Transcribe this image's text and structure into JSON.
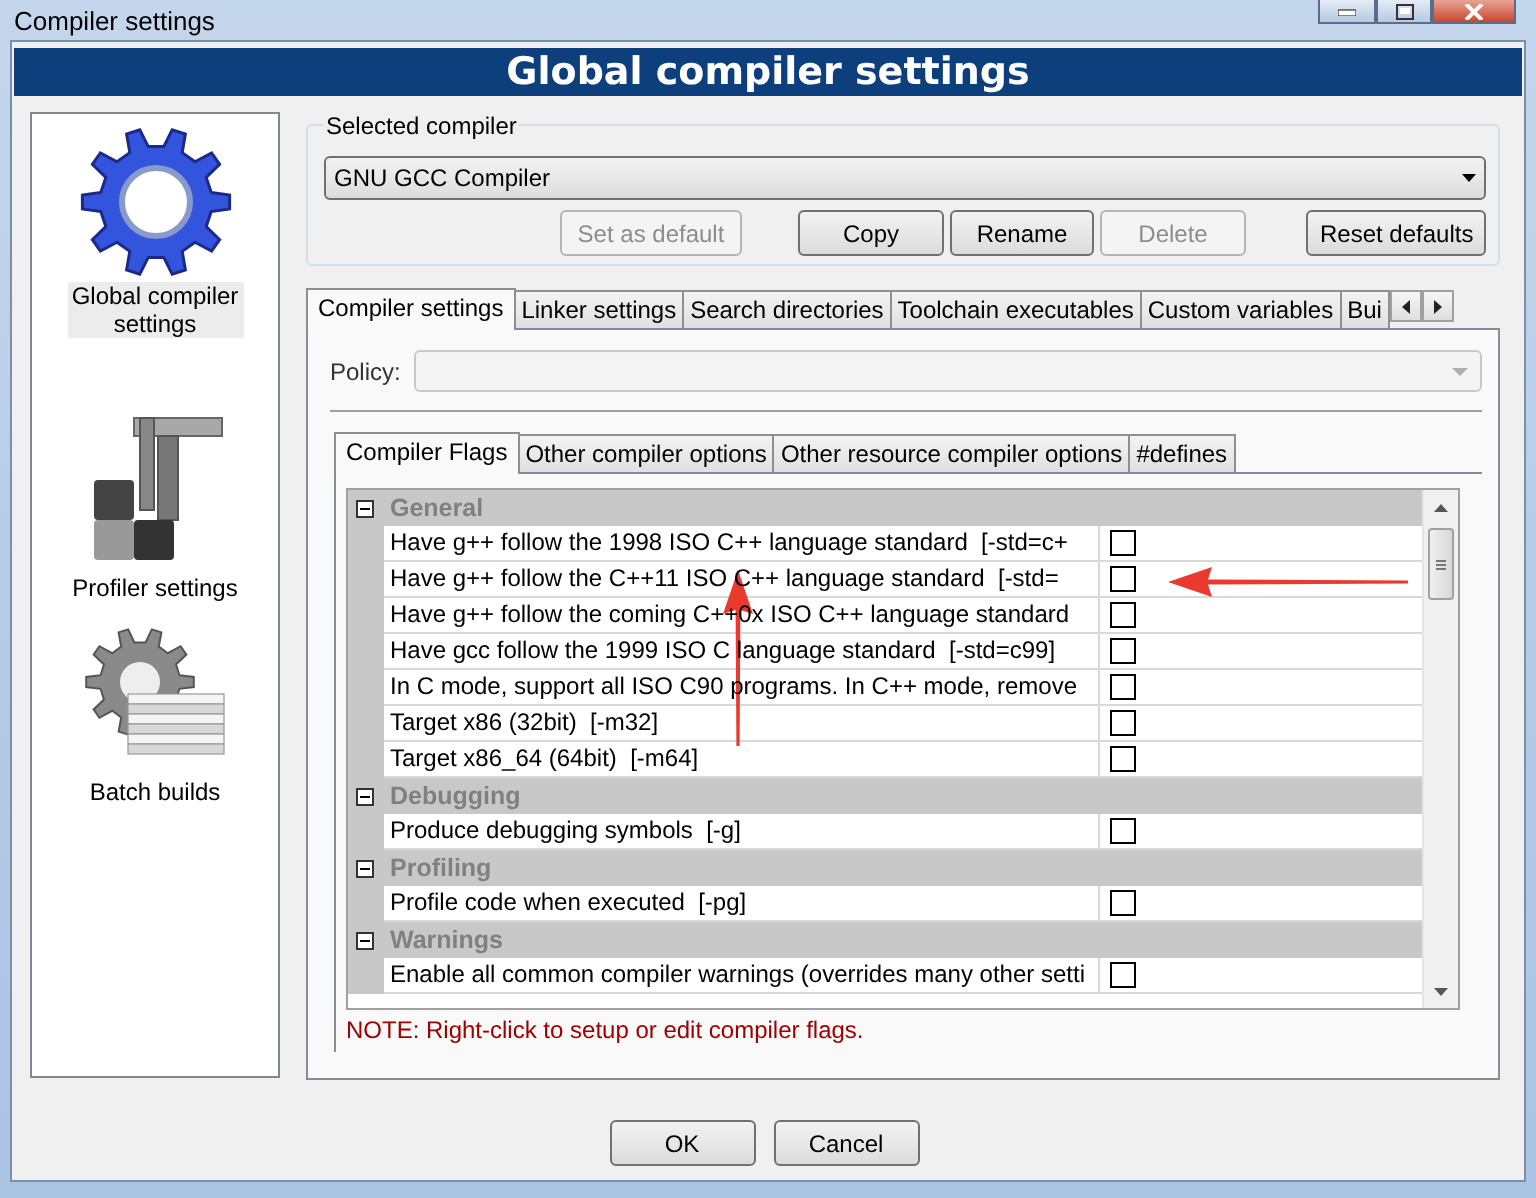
{
  "window": {
    "title": "Compiler settings"
  },
  "header": {
    "title": "Global compiler settings"
  },
  "sidebar": {
    "items": [
      {
        "label": "Global compiler settings",
        "kind": "gear",
        "selected": true
      },
      {
        "label": "Profiler settings",
        "kind": "profiler",
        "selected": false
      },
      {
        "label": "Batch builds",
        "kind": "batch",
        "selected": false
      }
    ]
  },
  "selected_compiler": {
    "label": "Selected compiler",
    "value": "GNU GCC Compiler",
    "buttons": [
      {
        "label": "Set as default",
        "disabled": true
      },
      {
        "label": "Copy",
        "disabled": false
      },
      {
        "label": "Rename",
        "disabled": false
      },
      {
        "label": "Delete",
        "disabled": true
      },
      {
        "label": "Reset defaults",
        "disabled": false
      }
    ]
  },
  "tabs": [
    {
      "label": "Compiler settings",
      "selected": true
    },
    {
      "label": "Linker settings",
      "selected": false
    },
    {
      "label": "Search directories",
      "selected": false
    },
    {
      "label": "Toolchain executables",
      "selected": false
    },
    {
      "label": "Custom variables",
      "selected": false
    },
    {
      "label": "Bui",
      "selected": false
    }
  ],
  "policy": {
    "label": "Policy:",
    "disabled": true
  },
  "sub_tabs": [
    {
      "label": "Compiler Flags",
      "selected": true
    },
    {
      "label": "Other compiler options",
      "selected": false
    },
    {
      "label": "Other resource compiler options",
      "selected": false
    },
    {
      "label": "#defines",
      "selected": false
    }
  ],
  "flags": {
    "groups": [
      {
        "name": "General",
        "expanded": true,
        "items": [
          {
            "label": "Have g++ follow the 1998 ISO C++ language standard  [-std=c+",
            "checked": false
          },
          {
            "label": "Have g++ follow the C++11 ISO C++ language standard  [-std=",
            "checked": false
          },
          {
            "label": "Have g++ follow the coming C++0x ISO C++ language standard",
            "checked": false
          },
          {
            "label": "Have gcc follow the 1999 ISO C language standard  [-std=c99]",
            "checked": false
          },
          {
            "label": "In C mode, support all ISO C90 programs. In C++ mode, remove",
            "checked": false
          },
          {
            "label": "Target x86 (32bit)  [-m32]",
            "checked": false
          },
          {
            "label": "Target x86_64 (64bit)  [-m64]",
            "checked": false
          }
        ]
      },
      {
        "name": "Debugging",
        "expanded": true,
        "items": [
          {
            "label": "Produce debugging symbols  [-g]",
            "checked": false
          }
        ]
      },
      {
        "name": "Profiling",
        "expanded": true,
        "items": [
          {
            "label": "Profile code when executed  [-pg]",
            "checked": false
          }
        ]
      },
      {
        "name": "Warnings",
        "expanded": true,
        "items": [
          {
            "label": "Enable all common compiler warnings (overrides many other setti",
            "checked": false
          }
        ]
      }
    ]
  },
  "note": "NOTE: Right-click to setup or edit compiler flags.",
  "annotations": [
    {
      "kind": "arrow-left"
    },
    {
      "kind": "arrow-up"
    }
  ],
  "footer_buttons": [
    "OK",
    "Cancel"
  ]
}
